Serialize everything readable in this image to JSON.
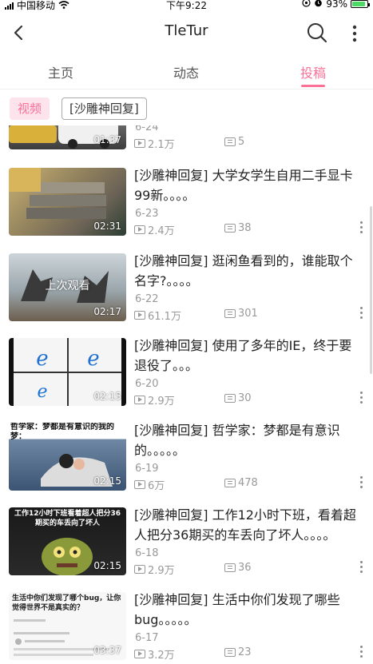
{
  "status_bar": {
    "carrier": "中国移动",
    "time": "下午9:22",
    "battery": "93%"
  },
  "header": {
    "title": "TleTur"
  },
  "tabs": [
    {
      "label": "主页",
      "active": false
    },
    {
      "label": "动态",
      "active": false
    },
    {
      "label": "投稿",
      "active": true
    }
  ],
  "filters": [
    {
      "label": "视频",
      "active": true
    },
    {
      "label": "[沙雕神回复]",
      "active": false
    }
  ],
  "colors": {
    "accent": "#fb7299",
    "chip_bg": "#fde3ec",
    "meta": "#999999"
  },
  "thumb_texts": {
    "last_watched": "上次观看",
    "t4_caption": "哲学家：梦都是有意识的我的梦：",
    "t5_caption": "工作12小时下班看着超人把分36期买的车丢向了坏人",
    "t6_caption": "生活中你们发现了哪个bug，让你觉得世界不是真实的？"
  },
  "videos": [
    {
      "title": "",
      "date": "6-24",
      "plays": "2.1万",
      "danmaku": "5",
      "duration": "01:37"
    },
    {
      "title": "[沙雕神回复] 大学女学生自用二手显卡99新。。。。",
      "date": "6-23",
      "plays": "2.4万",
      "danmaku": "38",
      "duration": "02:31"
    },
    {
      "title": "[沙雕神回复] 逛闲鱼看到的，谁能取个名字?。。。。",
      "date": "6-22",
      "plays": "61.1万",
      "danmaku": "301",
      "duration": "02:17"
    },
    {
      "title": "[沙雕神回复] 使用了多年的IE，终于要退役了。。。",
      "date": "6-20",
      "plays": "2.9万",
      "danmaku": "30",
      "duration": "02:15"
    },
    {
      "title": "[沙雕神回复] 哲学家：梦都是有意识的。。。。。",
      "date": "6-19",
      "plays": "6万",
      "danmaku": "478",
      "duration": "02:15"
    },
    {
      "title": "[沙雕神回复] 工作12小时下班，看着超人把分36期买的车丢向了坏人。。。。",
      "date": "6-18",
      "plays": "2.9万",
      "danmaku": "36",
      "duration": "02:15"
    },
    {
      "title": "[沙雕神回复] 生活中你们发现了哪些bug。。。。。",
      "date": "6-17",
      "plays": "3.2万",
      "danmaku": "23",
      "duration": "03:37"
    }
  ]
}
